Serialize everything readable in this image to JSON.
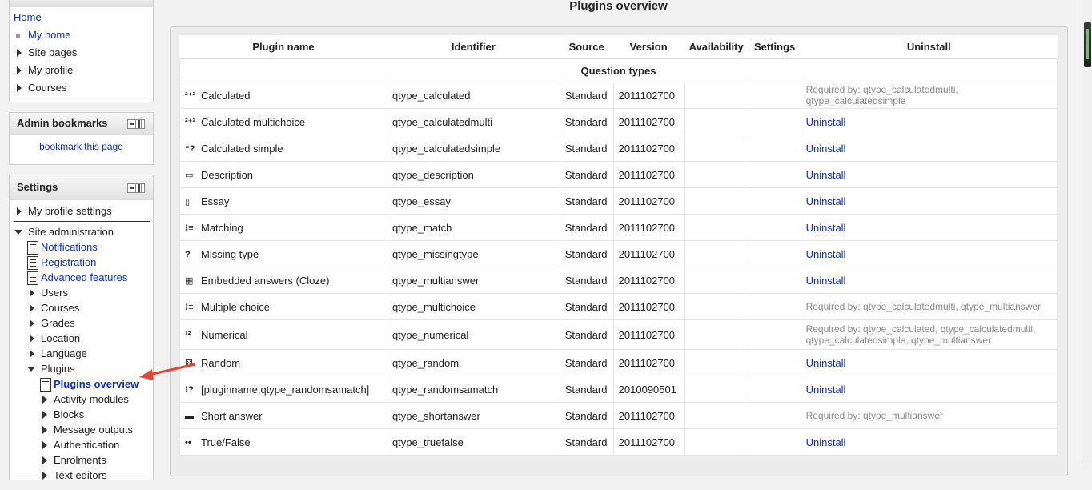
{
  "page_title": "Plugins overview",
  "navigation": {
    "items": [
      {
        "label": "Home"
      },
      {
        "label": "My home"
      },
      {
        "label": "Site pages"
      },
      {
        "label": "My profile"
      },
      {
        "label": "Courses"
      }
    ]
  },
  "admin_bookmarks": {
    "title": "Admin bookmarks",
    "link": "bookmark this page"
  },
  "settings": {
    "title": "Settings",
    "profile_settings": "My profile settings",
    "site_admin": "Site administration",
    "items": [
      {
        "label": "Notifications"
      },
      {
        "label": "Registration"
      },
      {
        "label": "Advanced features"
      },
      {
        "label": "Users"
      },
      {
        "label": "Courses"
      },
      {
        "label": "Grades"
      },
      {
        "label": "Location"
      },
      {
        "label": "Language"
      },
      {
        "label": "Plugins"
      }
    ],
    "plugins_children": [
      {
        "label": "Plugins overview"
      },
      {
        "label": "Activity modules"
      },
      {
        "label": "Blocks"
      },
      {
        "label": "Message outputs"
      },
      {
        "label": "Authentication"
      },
      {
        "label": "Enrolments"
      },
      {
        "label": "Text editors"
      }
    ]
  },
  "table": {
    "headers": [
      "Plugin name",
      "Identifier",
      "Source",
      "Version",
      "Availability",
      "Settings",
      "Uninstall"
    ],
    "group": "Question types",
    "rows": [
      {
        "icon": "calculated-icon",
        "name": "Calculated",
        "id": "qtype_calculated",
        "source": "Standard",
        "version": "2011102700",
        "uninstall": "",
        "required": "Required by: qtype_calculatedmulti, qtype_calculatedsimple"
      },
      {
        "icon": "calculated-multi-icon",
        "name": "Calculated multichoice",
        "id": "qtype_calculatedmulti",
        "source": "Standard",
        "version": "2011102700",
        "uninstall": "Uninstall",
        "required": ""
      },
      {
        "icon": "calculated-simple-icon",
        "name": "Calculated simple",
        "id": "qtype_calculatedsimple",
        "source": "Standard",
        "version": "2011102700",
        "uninstall": "Uninstall",
        "required": ""
      },
      {
        "icon": "description-icon",
        "name": "Description",
        "id": "qtype_description",
        "source": "Standard",
        "version": "2011102700",
        "uninstall": "Uninstall",
        "required": ""
      },
      {
        "icon": "essay-icon",
        "name": "Essay",
        "id": "qtype_essay",
        "source": "Standard",
        "version": "2011102700",
        "uninstall": "Uninstall",
        "required": ""
      },
      {
        "icon": "matching-icon",
        "name": "Matching",
        "id": "qtype_match",
        "source": "Standard",
        "version": "2011102700",
        "uninstall": "Uninstall",
        "required": ""
      },
      {
        "icon": "question-mark-icon",
        "name": "Missing type",
        "id": "qtype_missingtype",
        "source": "Standard",
        "version": "2011102700",
        "uninstall": "Uninstall",
        "required": ""
      },
      {
        "icon": "cloze-icon",
        "name": "Embedded answers (Cloze)",
        "id": "qtype_multianswer",
        "source": "Standard",
        "version": "2011102700",
        "uninstall": "Uninstall",
        "required": ""
      },
      {
        "icon": "multichoice-icon",
        "name": "Multiple choice",
        "id": "qtype_multichoice",
        "source": "Standard",
        "version": "2011102700",
        "uninstall": "",
        "required": "Required by: qtype_calculatedmulti, qtype_multianswer"
      },
      {
        "icon": "numerical-icon",
        "name": "Numerical",
        "id": "qtype_numerical",
        "source": "Standard",
        "version": "2011102700",
        "uninstall": "",
        "required": "Required by: qtype_calculated, qtype_calculatedmulti, qtype_calculatedsimple, qtype_multianswer"
      },
      {
        "icon": "dice-icon",
        "name": "Random",
        "id": "qtype_random",
        "source": "Standard",
        "version": "2011102700",
        "uninstall": "Uninstall",
        "required": ""
      },
      {
        "icon": "random-match-icon",
        "name": "[pluginname,qtype_randomsamatch]",
        "id": "qtype_randomsamatch",
        "source": "Standard",
        "version": "2010090501",
        "uninstall": "Uninstall",
        "required": ""
      },
      {
        "icon": "short-answer-icon",
        "name": "Short answer",
        "id": "qtype_shortanswer",
        "source": "Standard",
        "version": "2011102700",
        "uninstall": "",
        "required": "Required by: qtype_multianswer"
      },
      {
        "icon": "truefalse-icon",
        "name": "True/False",
        "id": "qtype_truefalse",
        "source": "Standard",
        "version": "2011102700",
        "uninstall": "Uninstall",
        "required": ""
      }
    ]
  },
  "colors": {
    "link": "#0a2eca",
    "annotation_arrow": "#e8423b",
    "muted_text": "#8a8a8a"
  }
}
